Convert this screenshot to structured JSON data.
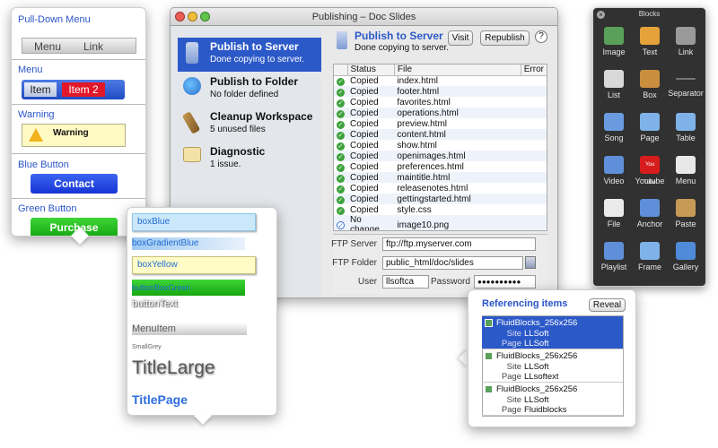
{
  "left_popover": {
    "pulldown_label": "Pull-Down Menu",
    "pulldown_items": [
      "Menu",
      "Link"
    ],
    "menu_label": "Menu",
    "menu_items": [
      "Item",
      "Item 2"
    ],
    "warning_label": "Warning",
    "warning_text": "Warning",
    "blue_button_label": "Blue Button",
    "blue_button_text": "Contact",
    "green_button_label": "Green Button",
    "green_button_text": "Purchase"
  },
  "window": {
    "title": "Publishing – Doc Slides",
    "sidebar": [
      {
        "title": "Publish to Server",
        "subtitle": "Done copying to server."
      },
      {
        "title": "Publish to Folder",
        "subtitle": "No folder defined"
      },
      {
        "title": "Cleanup Workspace",
        "subtitle": "5 unused files"
      },
      {
        "title": "Diagnostic",
        "subtitle": "1 issue."
      }
    ],
    "header": {
      "title": "Publish to Server",
      "subtitle": "Done copying to server.",
      "visit": "Visit",
      "republish": "Republish",
      "help": "?"
    },
    "columns": [
      "Status",
      "File",
      "Error"
    ],
    "rows": [
      {
        "status": "Copied",
        "file": "index.html"
      },
      {
        "status": "Copied",
        "file": "footer.html"
      },
      {
        "status": "Copied",
        "file": "favorites.html"
      },
      {
        "status": "Copied",
        "file": "operations.html"
      },
      {
        "status": "Copied",
        "file": "preview.html"
      },
      {
        "status": "Copied",
        "file": "content.html"
      },
      {
        "status": "Copied",
        "file": "show.html"
      },
      {
        "status": "Copied",
        "file": "openimages.html"
      },
      {
        "status": "Copied",
        "file": "preferences.html"
      },
      {
        "status": "Copied",
        "file": "maintitle.html"
      },
      {
        "status": "Copied",
        "file": "releasenotes.html"
      },
      {
        "status": "Copied",
        "file": "gettingstarted.html"
      },
      {
        "status": "Copied",
        "file": "style.css"
      },
      {
        "status": "No change",
        "file": "image10.png"
      }
    ],
    "ftp": {
      "server_label": "FTP Server",
      "server_value": "ftp://ftp.myserver.com",
      "folder_label": "FTP Folder",
      "folder_value": "public_html/doc/slides",
      "user_label": "User",
      "user_value": "llsoftca",
      "password_label": "Password",
      "password_value": "●●●●●●●●●●"
    }
  },
  "blocks": {
    "title": "Blocks",
    "items": [
      "Image",
      "Text",
      "Link",
      "List",
      "Box",
      "Separator",
      "Song",
      "Page",
      "Table",
      "Video",
      "Youtube",
      "Menu",
      "File",
      "Anchor",
      "Paste",
      "Playlist",
      "Frame",
      "Gallery"
    ],
    "youtube_logo": "You Tube"
  },
  "styles": {
    "items": [
      "boxBlue",
      "boxGradientBlue",
      "boxYellow",
      "buttonBoxGreen",
      "buttonText",
      "MenuItem",
      "SmallGrey",
      "TitleLarge",
      "TitlePage"
    ]
  },
  "referencing": {
    "title": "Referencing items",
    "reveal": "Reveal",
    "site_label": "Site",
    "page_label": "Page",
    "items": [
      {
        "name": "FluidBlocks_256x256",
        "site": "LLSoft",
        "page": "LLSoft"
      },
      {
        "name": "FluidBlocks_256x256",
        "site": "LLSoft",
        "page": "LLsoftext"
      },
      {
        "name": "FluidBlocks_256x256",
        "site": "LLSoft",
        "page": "Fluidblocks"
      }
    ]
  },
  "colors": {
    "accent": "#2c59c8",
    "link_blue": "#2a55c9",
    "green": "#3ea23b"
  }
}
